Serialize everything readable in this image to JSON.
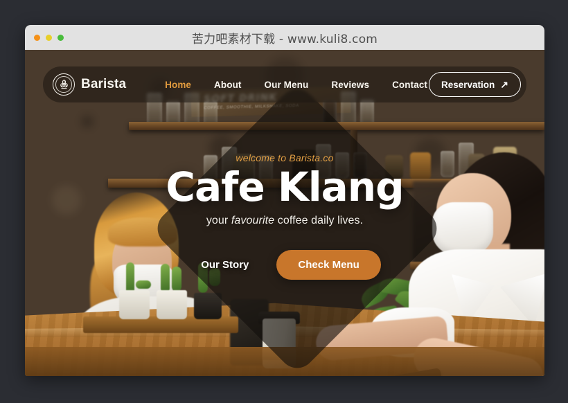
{
  "window": {
    "title": "苦力吧素材下载 - www.kuli8.com",
    "traffic_lights": [
      {
        "name": "close",
        "color": "#f59118"
      },
      {
        "name": "minimize",
        "color": "#e8cf2a"
      },
      {
        "name": "maximize",
        "color": "#49bc3c"
      }
    ]
  },
  "site": {
    "brand": {
      "name": "Barista",
      "logo_icon": "coffee-bean-badge-icon"
    },
    "nav": [
      {
        "label": "Home",
        "active": true
      },
      {
        "label": "About",
        "active": false
      },
      {
        "label": "Our Menu",
        "active": false
      },
      {
        "label": "Reviews",
        "active": false
      },
      {
        "label": "Contact",
        "active": false
      }
    ],
    "reservation": {
      "label": "Reservation",
      "icon": "arrow-up-right-icon"
    }
  },
  "hero": {
    "eyebrow": "welcome to Barista.co",
    "title": "Cafe Klang",
    "subtitle_before": "your ",
    "subtitle_emphasis": "favourite",
    "subtitle_after": " coffee daily lives.",
    "primary_action": "Check Menu",
    "secondary_action": "Our Story"
  },
  "background_photo": {
    "description": "Two masked baristas behind a wooden cafe counter handing over a takeaway coffee cup",
    "chalkboard_sign_title": "SOFT DRINK",
    "chalkboard_sign_subtitle": "COFFEE, SMOOTHIE, MILKSHAKE, SODA"
  },
  "colors": {
    "accent_orange": "#c8762b",
    "nav_active": "#e09a3e",
    "eyebrow": "#e4a044",
    "navbar_bg": "rgba(30,24,19,.58)",
    "diamond_overlay": "rgba(18,14,11,.62)",
    "titlebar_bg": "#e2e2e2",
    "desktop_bg": "#2b2d33",
    "text_light": "#f7f4ee"
  }
}
